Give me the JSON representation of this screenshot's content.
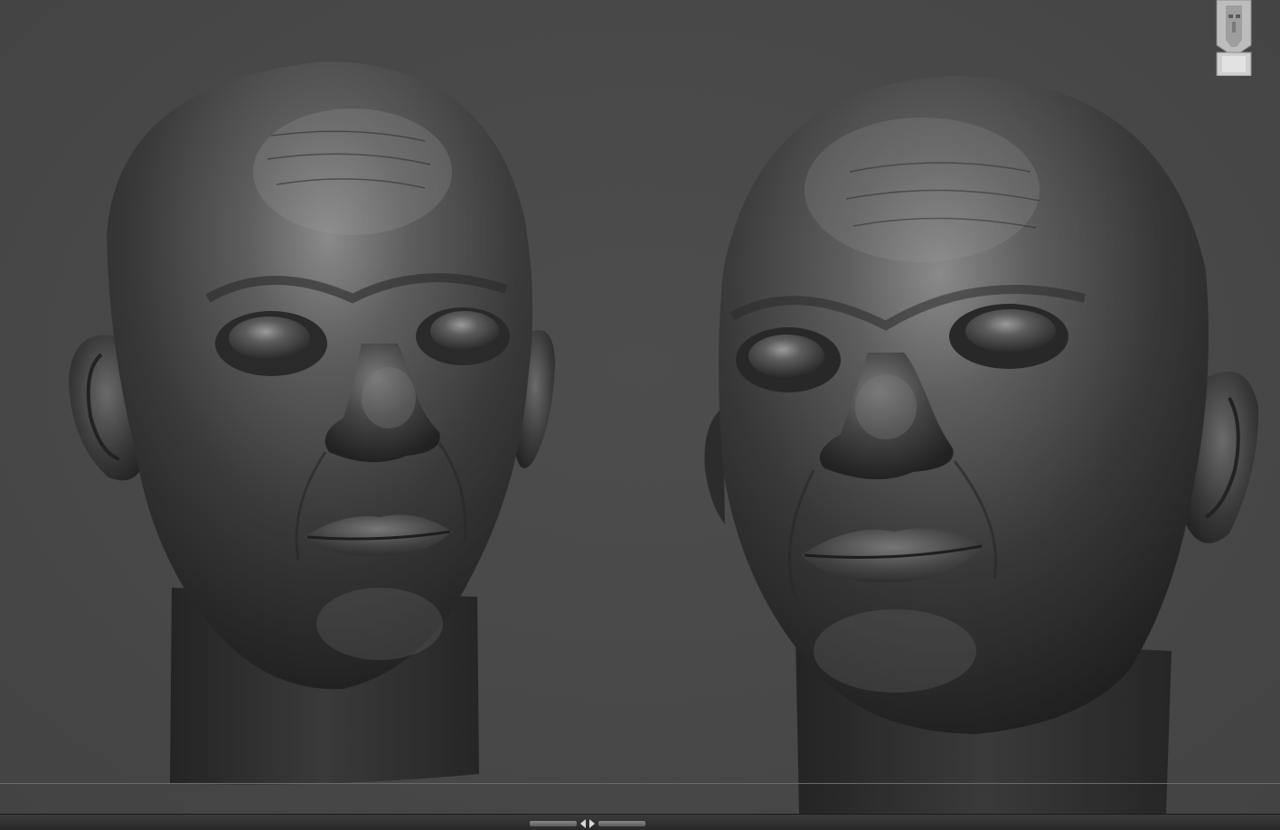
{
  "viewport": {
    "background": "#474747",
    "models": [
      {
        "id": "head-front",
        "view": "front",
        "material": "matcap-clay-dark"
      },
      {
        "id": "head-three-quarter",
        "view": "three-quarter",
        "material": "matcap-clay-dark"
      }
    ]
  },
  "navigation": {
    "icon": "head-navigation-cube-icon"
  },
  "bottom_tray": {
    "toggle_icon": "expand-collapse-arrows-icon"
  }
}
